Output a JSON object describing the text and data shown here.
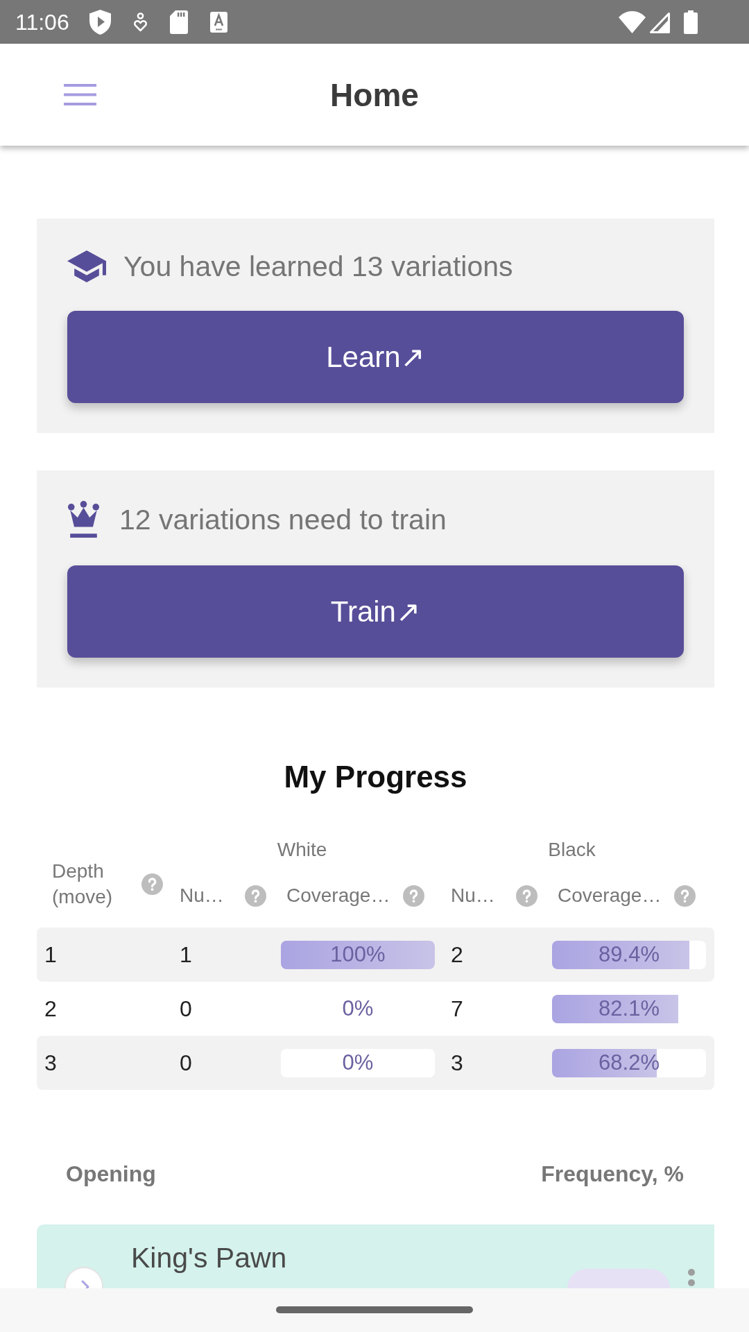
{
  "status_bar": {
    "time": "11:06"
  },
  "app_bar": {
    "title": "Home"
  },
  "summary_cards": [
    {
      "kind": "learn",
      "message": "You have learned 13 variations",
      "button": "Learn↗"
    },
    {
      "kind": "train",
      "message": "12 variations need to train",
      "button": "Train↗"
    }
  ],
  "progress": {
    "title": "My Progress",
    "header": {
      "depth": "Depth (move)",
      "white": {
        "title": "White",
        "count": "Nu…",
        "coverage": "Coverage…"
      },
      "black": {
        "title": "Black",
        "count": "Nu…",
        "coverage": "Coverage…"
      }
    },
    "rows": [
      {
        "depth": "1",
        "white": {
          "count": "1",
          "coverage": "100%",
          "level": 1
        },
        "black": {
          "count": "2",
          "coverage": "89.4%",
          "level": 0.894
        }
      },
      {
        "depth": "2",
        "white": {
          "count": "0",
          "coverage": "0%",
          "level": 0
        },
        "black": {
          "count": "7",
          "coverage": "82.1%",
          "level": 0.821
        }
      },
      {
        "depth": "3",
        "white": {
          "count": "0",
          "coverage": "0%",
          "level": 0
        },
        "black": {
          "count": "3",
          "coverage": "68.2%",
          "level": 0.682
        }
      }
    ]
  },
  "openings": {
    "columns": [
      "Opening",
      "Frequency, %"
    ],
    "items": [
      {
        "name": "King's Pawn"
      }
    ]
  }
}
